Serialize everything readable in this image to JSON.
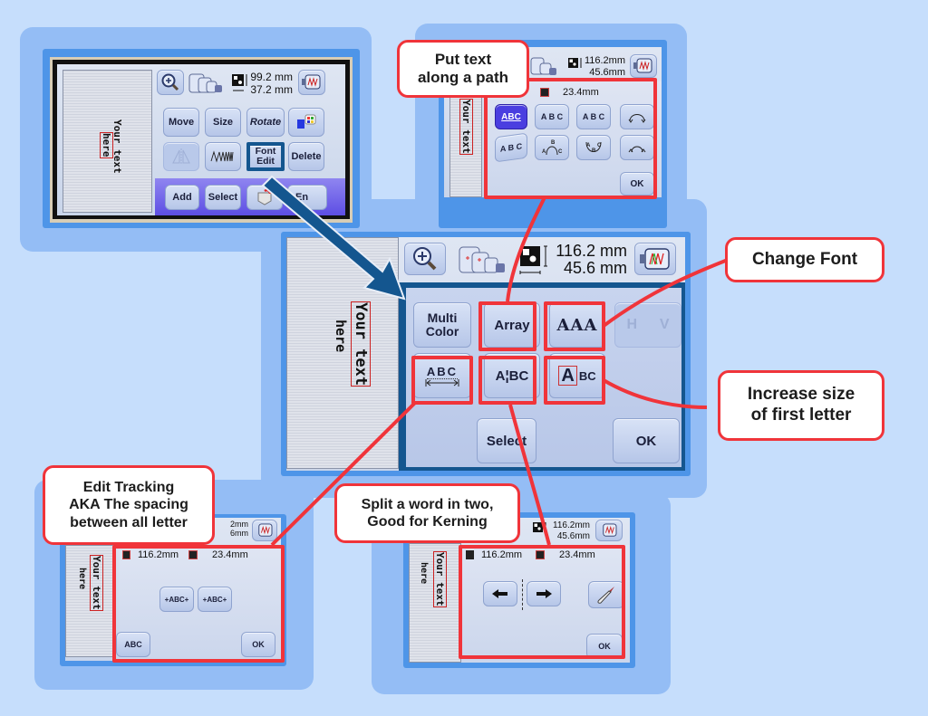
{
  "colors": {
    "background": "#c6defc",
    "card": "#94bdf5",
    "frame": "#4e95e8",
    "callout_border": "#f0343a",
    "arrow": "#14568f",
    "selected_button": "#4a3ee0"
  },
  "panel_main_edit": {
    "canvas_text": [
      "Your text",
      "here"
    ],
    "dims": [
      "99.2 mm",
      "37.2 mm"
    ],
    "buttons": {
      "move": "Move",
      "size": "Size",
      "rotate": "Rotate",
      "font_edit": "Font\nEdit",
      "delete": "Delete",
      "add": "Add",
      "select": "Select",
      "end": "En"
    },
    "icons": [
      "zoom-icon",
      "hoop-icon",
      "dimension-icon",
      "embroidery-icon",
      "color-thread-icon",
      "mirror-icon",
      "stitch-density-icon",
      "pocket-icon"
    ]
  },
  "panel_font_edit": {
    "canvas_text": [
      "Your text",
      "here"
    ],
    "dims": [
      "116.2 mm",
      "45.6 mm"
    ],
    "buttons": {
      "multi_color": "Multi\nColor",
      "array": "Array",
      "font_change": "AAA",
      "hv_h": "H",
      "hv_v": "V",
      "spacing": "ABC",
      "split": "A¦BC",
      "first_letter_big": "A",
      "first_letter_rest": "BC",
      "select": "Select",
      "ok": "OK"
    }
  },
  "panel_array": {
    "dim_partial": ".2mm",
    "dim_width": "23.4mm",
    "dims": [
      "116.2mm",
      "45.6mm"
    ],
    "buttons": [
      "ABC",
      "A B C",
      "A B C",
      "",
      "A B C",
      "B",
      "B",
      ""
    ],
    "ok": "OK"
  },
  "panel_tracking": {
    "dims_partial": [
      "2mm",
      "6mm"
    ],
    "dim_height": "116.2mm",
    "dim_width": "23.4mm",
    "buttons": {
      "expand": "+ABC+",
      "contract": "+ABC+",
      "reset": "ABC",
      "ok": "OK"
    }
  },
  "panel_split": {
    "dims": [
      "116.2mm",
      "45.6mm"
    ],
    "dim_height": "116.2mm",
    "dim_width": "23.4mm",
    "ok": "OK"
  },
  "callouts": {
    "array": "Put text\nalong a path",
    "font": "Change Font",
    "first_letter": "Increase size\nof first letter",
    "tracking": "Edit Tracking\nAKA The spacing\nbetween all letter",
    "split": "Split a word in two,\nGood for Kerning"
  }
}
